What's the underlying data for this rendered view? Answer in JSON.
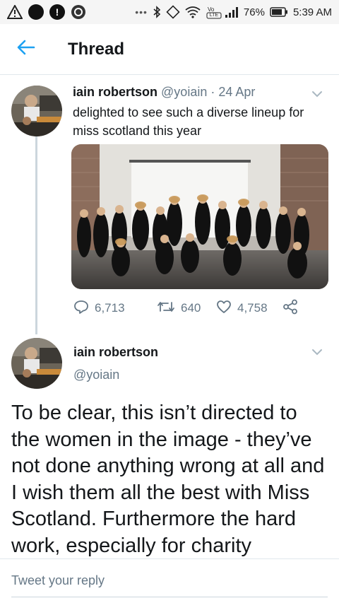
{
  "status_bar": {
    "time": "5:39 AM",
    "battery": "76%",
    "network_badge": "LTE",
    "icons": [
      "warning-icon",
      "record-icon",
      "alert-icon",
      "app-icon",
      "more-dots-icon",
      "bluetooth-icon",
      "rotate-icon",
      "wifi-icon",
      "volte-icon",
      "signal-icon",
      "battery-icon"
    ]
  },
  "header": {
    "title": "Thread",
    "back_icon": "back-arrow-icon",
    "accent_color": "#1da1f2"
  },
  "tweet1": {
    "name": "iain robertson",
    "handle": "@yoiain",
    "separator": "·",
    "date": "24 Apr",
    "text": "delighted to see such a diverse lineup for miss scotland this year",
    "image_alt": "group photo of contestants",
    "replies": "6,713",
    "retweets": "640",
    "likes": "4,758"
  },
  "tweet2": {
    "name": "iain robertson",
    "handle": "@yoiain",
    "text": "To be clear, this isn’t directed to the women in the image - they’ve not done anything wrong at all and I wish them all the best with Miss Scotland. Furthermore the hard work, especially for charity"
  },
  "reply": {
    "placeholder": "Tweet your reply"
  }
}
